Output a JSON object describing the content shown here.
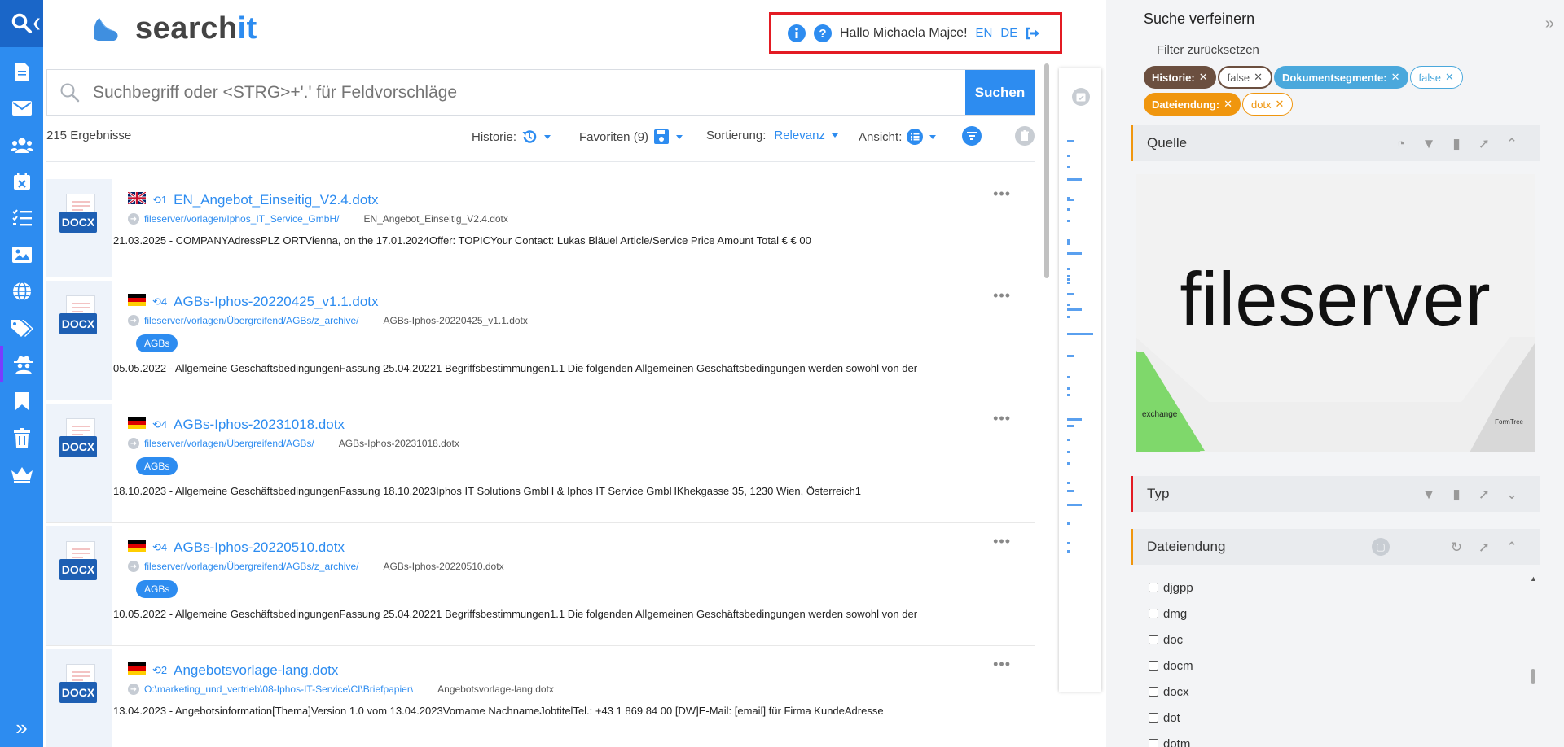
{
  "app": {
    "brand_prefix": "search",
    "brand_suffix": "it",
    "accent_color": "#2d8cf0"
  },
  "nav": {
    "items": [
      {
        "icon": "document-icon"
      },
      {
        "icon": "mail-icon"
      },
      {
        "icon": "users-icon"
      },
      {
        "icon": "calendar-icon"
      },
      {
        "icon": "tasks-icon"
      },
      {
        "icon": "image-icon"
      },
      {
        "icon": "globe-icon"
      },
      {
        "icon": "tags-icon"
      },
      {
        "icon": "spy-icon"
      },
      {
        "icon": "bookmark-icon"
      },
      {
        "icon": "trash-icon"
      },
      {
        "icon": "crown-icon"
      }
    ],
    "expand_label": "»"
  },
  "user": {
    "greeting": "Hallo Michaela Majce!",
    "lang_en": "EN",
    "lang_de": "DE"
  },
  "search": {
    "placeholder": "Suchbegriff oder <STRG>+'.' für Feldvorschläge",
    "button_label": "Suchen"
  },
  "toolbar": {
    "result_count": "215 Ergebnisse",
    "history_label": "Historie:",
    "favorites_label": "Favoriten (9)",
    "sort_label": "Sortierung:",
    "sort_value": "Relevanz",
    "view_label": "Ansicht:"
  },
  "results": [
    {
      "flag": "uk",
      "version": "1",
      "title": "EN_Angebot_Einseitig_V2.4.dotx",
      "path": "fileserver/vorlagen/Iphos_IT_Service_GmbH/",
      "filename": "EN_Angebot_Einseitig_V2.4.dotx",
      "badge": "",
      "date": "21.03.2025",
      "snippet": "COMPANYAdressPLZ ORTVienna, on the 17.01.2024Offer: TOPICYour Contact: Lukas Bläuel Article/Service Price Amount Total € € 00"
    },
    {
      "flag": "de",
      "version": "4",
      "title": "AGBs-Iphos-20220425_v1.1.dotx",
      "path": "fileserver/vorlagen/Übergreifend/AGBs/z_archive/",
      "filename": "AGBs-Iphos-20220425_v1.1.dotx",
      "badge": "AGBs",
      "date": "05.05.2022",
      "snippet": "Allgemeine GeschäftsbedingungenFassung 25.04.20221 Begriffsbestimmungen1.1 Die folgenden Allgemeinen Geschäftsbedingungen werden sowohl von der"
    },
    {
      "flag": "de",
      "version": "4",
      "title": "AGBs-Iphos-20231018.dotx",
      "path": "fileserver/vorlagen/Übergreifend/AGBs/",
      "filename": "AGBs-Iphos-20231018.dotx",
      "badge": "AGBs",
      "date": "18.10.2023",
      "snippet": "Allgemeine GeschäftsbedingungenFassung 18.10.2023Iphos IT Solutions GmbH & Iphos IT Service GmbHKhekgasse 35, 1230 Wien, Österreich1"
    },
    {
      "flag": "de",
      "version": "4",
      "title": "AGBs-Iphos-20220510.dotx",
      "path": "fileserver/vorlagen/Übergreifend/AGBs/z_archive/",
      "filename": "AGBs-Iphos-20220510.dotx",
      "badge": "AGBs",
      "date": "10.05.2022",
      "snippet": "Allgemeine GeschäftsbedingungenFassung 25.04.20221 Begriffsbestimmungen1.1 Die folgenden Allgemeinen Geschäftsbedingungen werden sowohl von der"
    },
    {
      "flag": "de",
      "version": "2",
      "title": "Angebotsvorlage-lang.dotx",
      "path": "O:\\marketing_und_vertrieb\\08-Iphos-IT-Service\\CI\\Briefpapier\\",
      "filename": "Angebotsvorlage-lang.dotx",
      "badge": "",
      "date": "13.04.2023",
      "snippet": "Angebotsinformation[Thema]Version 1.0 vom 13.04.2023Vorname NachnameJobtitelTel.: +43 1 869 84 00 [DW]E-Mail: [email] für Firma KundeAdresse"
    }
  ],
  "doc_icon_label": "DOCX",
  "refine": {
    "title": "Suche verfeinern",
    "reset": "Filter zurücksetzen",
    "chips": [
      {
        "style": "brown",
        "label": "Historie:"
      },
      {
        "style": "brownout",
        "label": "false"
      },
      {
        "style": "blue",
        "label": "Dokumentsegmente:"
      },
      {
        "style": "blueout",
        "label": "false"
      },
      {
        "style": "orange",
        "label": "Dateiendung:"
      },
      {
        "style": "orangeout",
        "label": "dotx"
      }
    ],
    "sections": {
      "quelle": "Quelle",
      "typ": "Typ",
      "dateiendung": "Dateiendung"
    },
    "source_chart": {
      "big_label": "fileserver",
      "small_left": "exchange",
      "small_right": "FormTree"
    },
    "extensions": [
      "djgpp",
      "dmg",
      "doc",
      "docm",
      "docx",
      "dot",
      "dotm"
    ]
  }
}
